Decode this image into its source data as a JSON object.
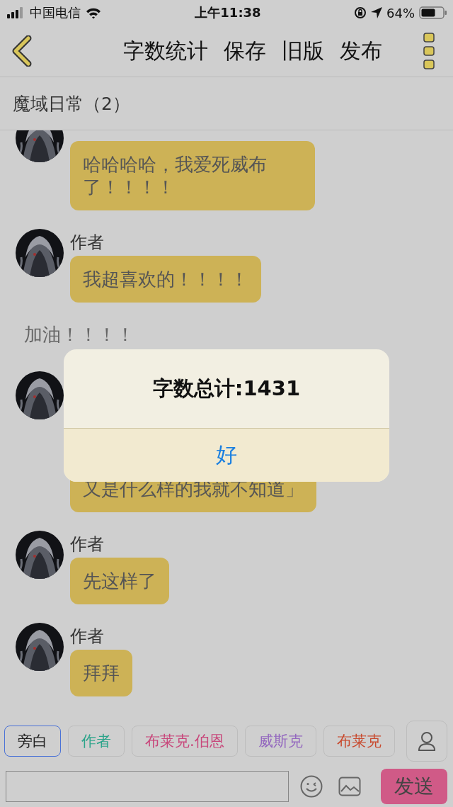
{
  "status_bar": {
    "carrier": "中国电信",
    "time": "上午11:38",
    "battery": "64%"
  },
  "toolbar": {
    "actions": [
      "字数统计",
      "保存",
      "旧版",
      "发布"
    ]
  },
  "chat_title": "魔域日常（2）",
  "messages": [
    {
      "kind": "bubble",
      "text": "哈哈哈哈，我爱死威布了！！！！",
      "covered": false
    },
    {
      "kind": "bubble",
      "sender": "作者",
      "text": "我超喜欢的！！！！",
      "covered": false
    },
    {
      "kind": "narration",
      "text": "加油！！！！"
    },
    {
      "kind": "bubble",
      "text": "又是什么样的我就不知道」",
      "covered": true
    },
    {
      "kind": "bubble",
      "sender": "作者",
      "text": "先这样了",
      "covered": false
    },
    {
      "kind": "bubble",
      "sender": "作者",
      "text": "拜拜",
      "covered": false
    }
  ],
  "characters": [
    {
      "label": "旁白",
      "selected": true,
      "color": "#1e1e1e"
    },
    {
      "label": "作者",
      "selected": false,
      "color": "#2ba48a"
    },
    {
      "label": "布莱克.伯恩",
      "selected": false,
      "color": "#c8477b"
    },
    {
      "label": "威斯克",
      "selected": false,
      "color": "#9468bf"
    },
    {
      "label": "布莱克",
      "selected": false,
      "color": "#c84a2e"
    }
  ],
  "composer": {
    "send": "发送"
  },
  "alert": {
    "title": "字数总计:1431",
    "button": "好"
  }
}
